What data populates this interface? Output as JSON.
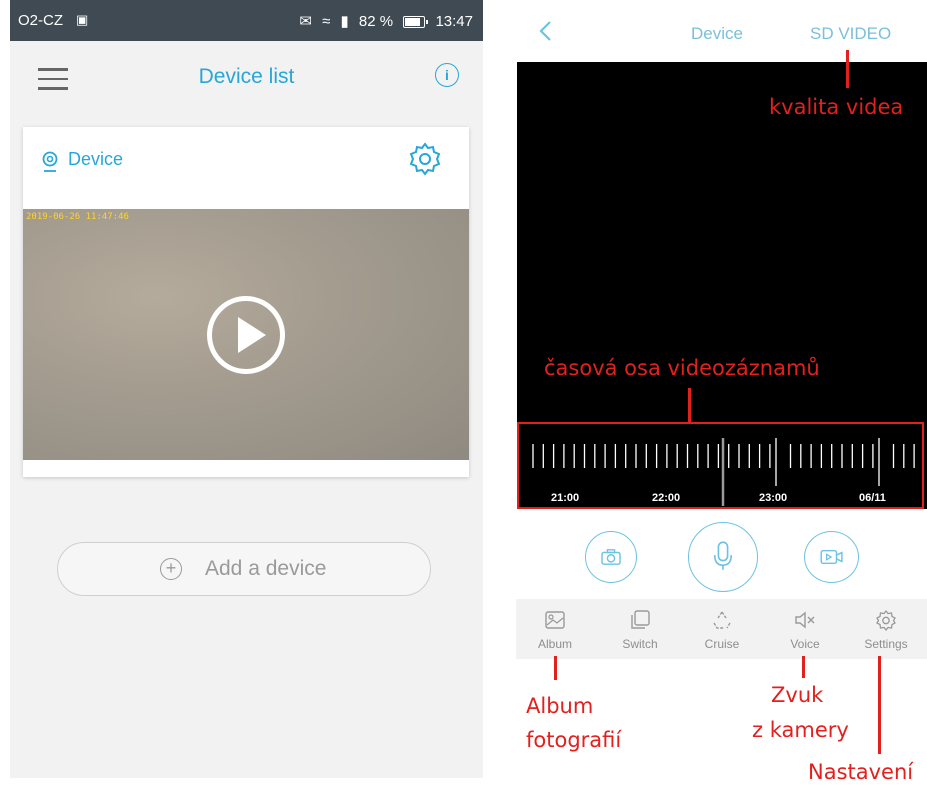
{
  "left": {
    "status_bar": {
      "carrier": "O2-CZ",
      "battery": "82 %",
      "time": "13:47"
    },
    "header": {
      "title": "Device list"
    },
    "device_card": {
      "name": "Device",
      "timestamp": "2019-06-26 11:47:46"
    },
    "add_device": {
      "label": "Add a device"
    }
  },
  "right": {
    "header": {
      "title": "Device",
      "quality": "SD VIDEO"
    },
    "timeline": {
      "labels": [
        "21:00",
        "22:00",
        "23:00",
        "06/11"
      ]
    },
    "tabs": [
      "Album",
      "Switch",
      "Cruise",
      "Voice",
      "Settings"
    ],
    "annotations": {
      "quality": "kvalita videa",
      "timeline": "časová osa videozáznamů",
      "album_line1": "Album",
      "album_line2": "fotografií",
      "voice_line1": "Zvuk",
      "voice_line2": "z kamery",
      "settings": "Nastavení"
    }
  },
  "colors": {
    "accent": "#27a7d8",
    "annotation": "#e2201e",
    "status_bar": "#3f4a52"
  }
}
